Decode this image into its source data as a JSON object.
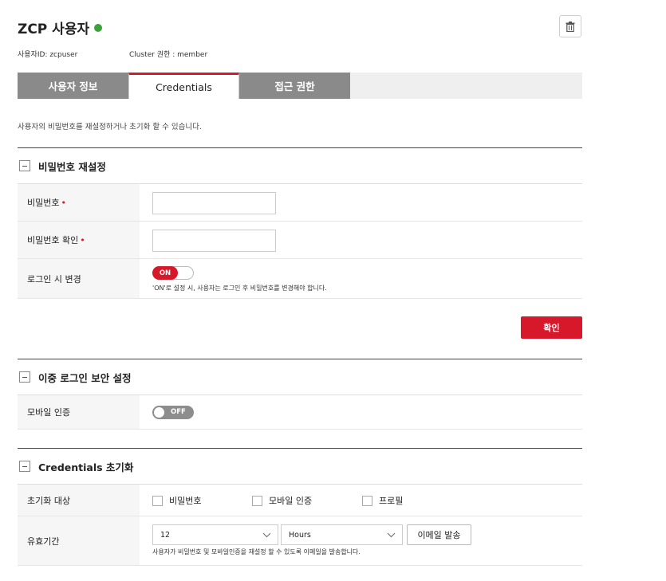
{
  "header": {
    "title": "ZCP 사용자",
    "user_id": "사용자ID: zcpuser",
    "cluster_role": "Cluster 권한 : member",
    "status_color": "#3aa23a",
    "delete_icon": "trash-icon"
  },
  "tabs": [
    {
      "label": "사용자 정보",
      "active": false
    },
    {
      "label": "Credentials",
      "active": true
    },
    {
      "label": "접근 권한",
      "active": false
    }
  ],
  "description": "사용자의 비밀번호를 재설정하거나 초기화 할 수 있습니다.",
  "password_section": {
    "title": "비밀번호 재설정",
    "password_label": "비밀번호",
    "password_value": "",
    "confirm_label": "비밀번호 확인",
    "confirm_value": "",
    "change_on_login_label": "로그인 시 변경",
    "toggle_label": "ON",
    "toggle_hint": "'ON'로 설정 시, 사용자는 로그인 후 비밀번호를 변경해야 합니다.",
    "required_mark": "•",
    "confirm_button": "확인"
  },
  "twofactor_section": {
    "title": "이중 로그인 보안 설정",
    "mobile_label": "모바일 인증",
    "toggle_label": "OFF"
  },
  "reset_section": {
    "title": "Credentials 초기화",
    "target_label": "초기화 대상",
    "options": [
      "비밀번호",
      "모바일 인증",
      "프로필"
    ],
    "period_label": "유효기간",
    "period_value": "12",
    "unit_value": "Hours",
    "email_button": "이메일 발송",
    "email_hint": "사용자가 비밀번호 및 모바일인증을 재설정 할 수 있도록 이메일을 발송합니다."
  },
  "colors": {
    "accent": "#d7182a",
    "tab_inactive": "#8a8a8a",
    "label_bg": "#f6f6f6"
  }
}
